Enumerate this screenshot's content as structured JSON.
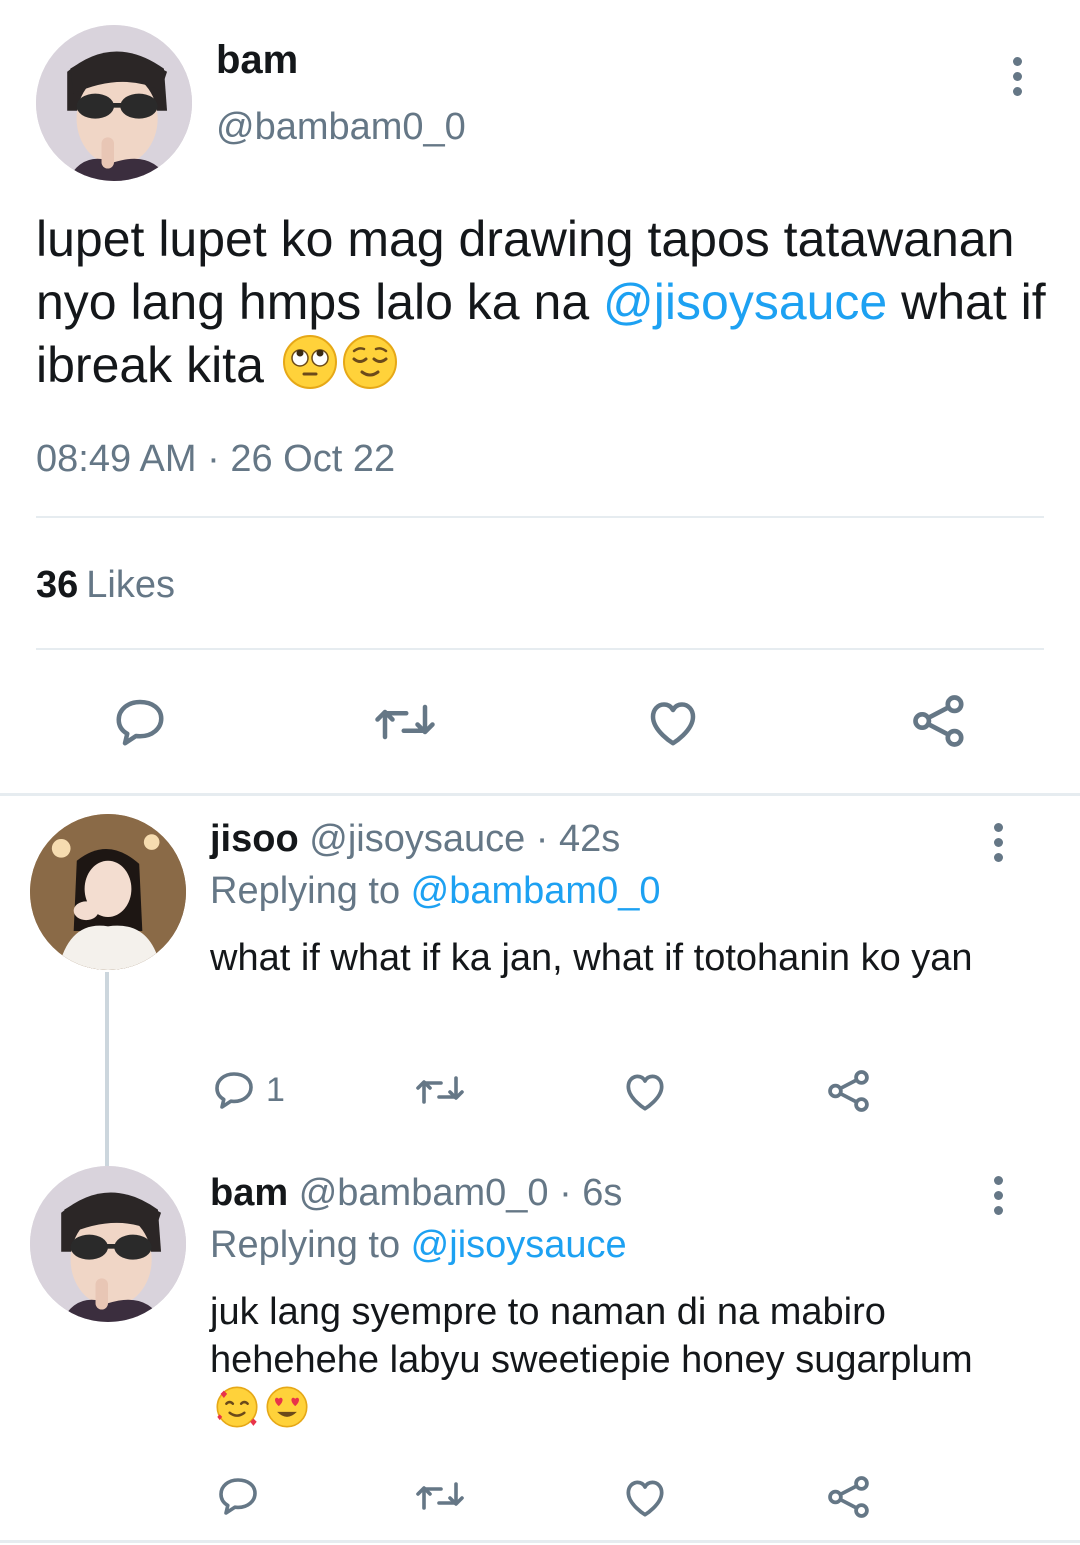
{
  "main_tweet": {
    "display_name": "bam",
    "handle": "@bambam0_0",
    "text_part1": "lupet lupet ko mag drawing tapos tatawanan nyo lang hmps lalo ka na ",
    "mention": "@jisoysauce",
    "text_part2": " what if ibreak kita ",
    "emojis": [
      "face-with-rolling-eyes-emoji",
      "relieved-face-emoji"
    ],
    "timestamp": "08:49 AM · 26 Oct 22",
    "likes_count": "36",
    "likes_label": "Likes",
    "actions": [
      "reply-icon",
      "retweet-icon",
      "like-icon",
      "share-icon"
    ]
  },
  "replies": [
    {
      "display_name": "jisoo",
      "meta": " @jisoysauce · 42s",
      "replying_prefix": "Replying to ",
      "replying_to": "@bambam0_0",
      "text": "what if what if ka jan, what if totohanin ko yan",
      "reply_count": "1"
    },
    {
      "display_name": "bam",
      "meta": " @bambam0_0 · 6s",
      "replying_prefix": "Replying to ",
      "replying_to": "@jisoysauce",
      "text": "juk lang syempre to naman di na mabiro hehehehe labyu sweetiepie honey sugarplum ",
      "emojis": [
        "smiling-face-with-hearts-emoji",
        "heart-eyes-emoji"
      ]
    }
  ],
  "colors": {
    "text": "#14171a",
    "secondary": "#657786",
    "link": "#1da1f2",
    "divider": "#e6ecf0"
  }
}
